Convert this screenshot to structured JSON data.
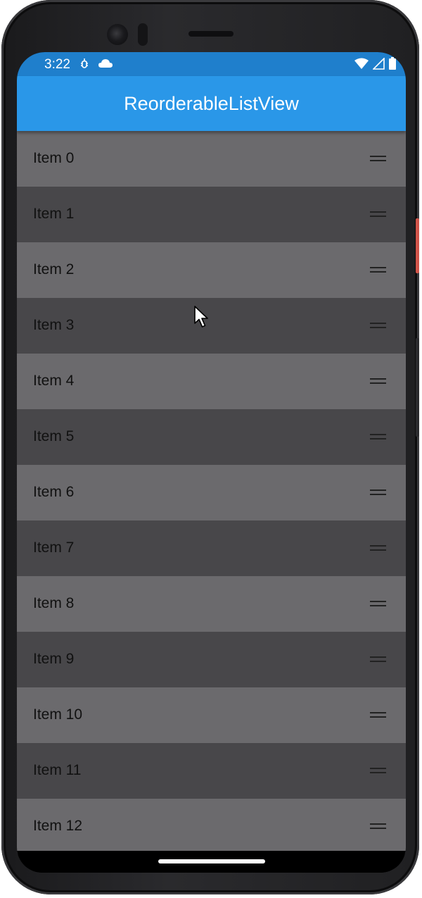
{
  "status_bar": {
    "time": "3:22",
    "left_icons": [
      "debug-icon",
      "cloud-icon"
    ],
    "right_icons": [
      "wifi-icon",
      "signal-icon",
      "battery-icon"
    ],
    "background_color": "#1f7fcc"
  },
  "app_bar": {
    "title": "ReorderableListView",
    "background_color": "#2a97e8"
  },
  "list": {
    "item_colors": {
      "light": "#6b6a6d",
      "dark": "#48474a"
    },
    "drag_handle_icon": "drag-handle-icon",
    "items": [
      {
        "label": "Item 0"
      },
      {
        "label": "Item 1"
      },
      {
        "label": "Item 2"
      },
      {
        "label": "Item 3"
      },
      {
        "label": "Item 4"
      },
      {
        "label": "Item 5"
      },
      {
        "label": "Item 6"
      },
      {
        "label": "Item 7"
      },
      {
        "label": "Item 8"
      },
      {
        "label": "Item 9"
      },
      {
        "label": "Item 10"
      },
      {
        "label": "Item 11"
      },
      {
        "label": "Item 12"
      }
    ]
  }
}
